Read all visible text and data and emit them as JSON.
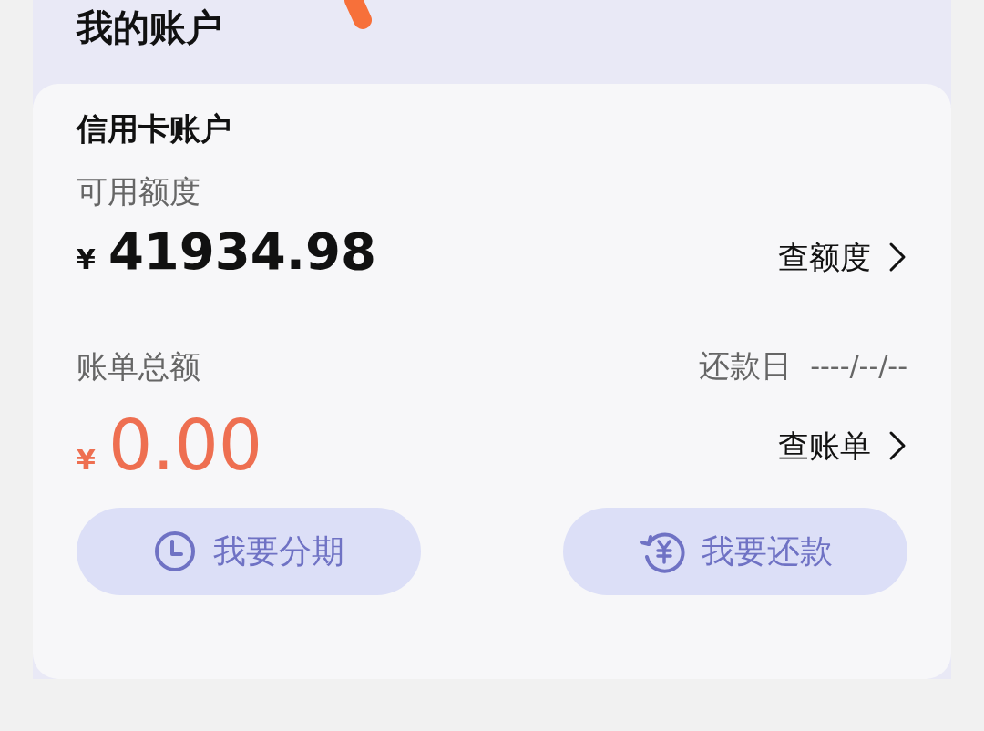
{
  "header": {
    "title": "我的账户"
  },
  "card": {
    "title": "信用卡账户",
    "available": {
      "label": "可用额度",
      "currency": "¥",
      "amount": "41934.98",
      "link": "查额度"
    },
    "bill": {
      "label": "账单总额",
      "due_label": "还款日",
      "due_date": "----/--/--",
      "currency": "¥",
      "amount": "0.00",
      "link": "查账单"
    },
    "buttons": [
      {
        "kind": "installment",
        "label": "我要分期"
      },
      {
        "kind": "repay",
        "label": "我要还款"
      }
    ]
  }
}
